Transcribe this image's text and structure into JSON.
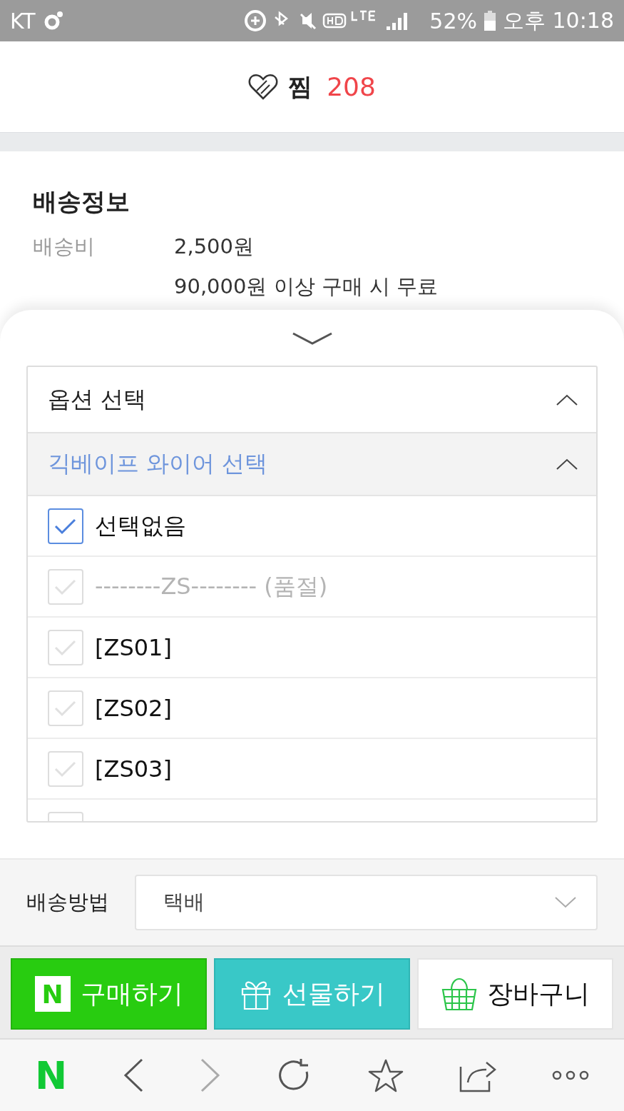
{
  "status_bar": {
    "carrier": "KT",
    "battery": "52%",
    "time": "오후 10:18"
  },
  "wishlist": {
    "label": "찜",
    "count": "208"
  },
  "shipping_info": {
    "title": "배송정보",
    "rows": [
      {
        "label": "배송비",
        "lines": [
          "2,500원",
          "90,000원 이상 구매 시 무료"
        ]
      }
    ]
  },
  "option_panel": {
    "title": "옵션 선택",
    "expanded": true,
    "group": {
      "title": "긱베이프 와이어 선택",
      "expanded": true,
      "options": [
        {
          "label": "선택없음",
          "checked": true,
          "disabled": false
        },
        {
          "label": "--------ZS-------- (품절)",
          "checked": false,
          "disabled": true
        },
        {
          "label": "[ZS01]",
          "checked": false,
          "disabled": false
        },
        {
          "label": "[ZS02]",
          "checked": false,
          "disabled": false
        },
        {
          "label": "[ZS03]",
          "checked": false,
          "disabled": false
        },
        {
          "checked": false
        }
      ]
    }
  },
  "delivery": {
    "label": "배송방법",
    "value": "택배"
  },
  "actions": [
    {
      "kind": "buy",
      "label": "구매하기",
      "logo": "N"
    },
    {
      "kind": "gift",
      "label": "선물하기"
    },
    {
      "kind": "cart",
      "label": "장바구니"
    }
  ],
  "browser_nav": {
    "logo": "N",
    "buttons": [
      {
        "kind": "back",
        "disabled": false
      },
      {
        "kind": "forward",
        "disabled": true
      },
      {
        "kind": "reload",
        "disabled": false
      },
      {
        "kind": "bookmark",
        "disabled": false
      },
      {
        "kind": "share",
        "disabled": false
      },
      {
        "kind": "more",
        "disabled": false
      }
    ]
  }
}
